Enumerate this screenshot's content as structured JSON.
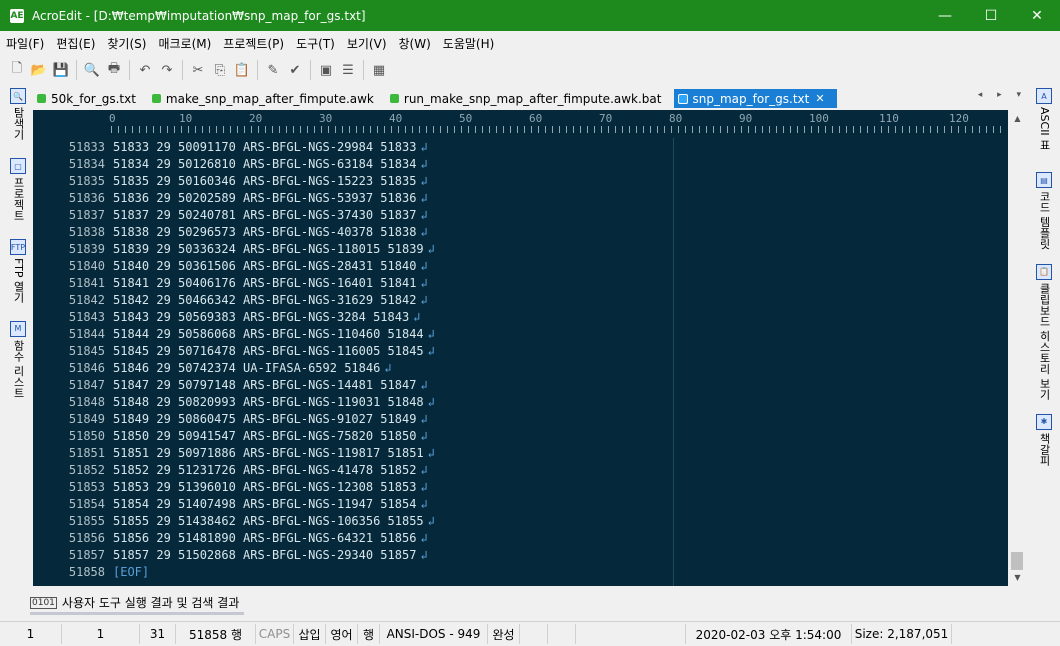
{
  "window": {
    "title": "AcroEdit - [D:₩temp₩imputation₩snp_map_for_gs.txt]",
    "app_icon": "AE",
    "controls": {
      "minimize": "—",
      "maximize": "☐",
      "close": "✕"
    }
  },
  "menubar": [
    "파일(F)",
    "편집(E)",
    "찾기(S)",
    "매크로(M)",
    "프로젝트(P)",
    "도구(T)",
    "보기(V)",
    "창(W)",
    "도움말(H)"
  ],
  "toolbar": [
    {
      "name": "new-file-icon",
      "glyph": "🗋"
    },
    {
      "name": "open-folder-icon",
      "glyph": "📂"
    },
    {
      "name": "save-icon",
      "glyph": "💾"
    },
    {
      "name": "print-preview-icon",
      "glyph": "🔍"
    },
    {
      "name": "print-icon",
      "glyph": "🖶"
    },
    {
      "name": "undo-icon",
      "glyph": "↶"
    },
    {
      "name": "redo-icon",
      "glyph": "↷"
    },
    {
      "name": "cut-icon",
      "glyph": "✂"
    },
    {
      "name": "copy-icon",
      "glyph": "⎘"
    },
    {
      "name": "paste-icon",
      "glyph": "📋"
    },
    {
      "name": "highlight-icon",
      "glyph": "✎"
    },
    {
      "name": "bookmark-icon",
      "glyph": "✔"
    },
    {
      "name": "document-icon",
      "glyph": "▣"
    },
    {
      "name": "list-icon",
      "glyph": "☰"
    },
    {
      "name": "calendar-icon",
      "glyph": "▦"
    }
  ],
  "tabs": [
    {
      "label": "50k_for_gs.txt",
      "active": false
    },
    {
      "label": "make_snp_map_after_fimpute.awk",
      "active": false
    },
    {
      "label": "run_make_snp_map_after_fimpute.awk.bat",
      "active": false
    },
    {
      "label": "snp_map_for_gs.txt",
      "active": true
    }
  ],
  "tab_close": "✕",
  "tab_nav": "◂ ▸ ▾",
  "left_dock": [
    {
      "label": "탐색기",
      "icon": "explorer-icon",
      "glyph": "🔍"
    },
    {
      "label": "프로젝트",
      "icon": "project-icon",
      "glyph": "▢"
    },
    {
      "label": "FTP 열기",
      "icon": "ftp-icon",
      "glyph": "FTP"
    },
    {
      "label": "함수 리스트",
      "icon": "function-list-icon",
      "glyph": "M"
    }
  ],
  "right_dock": [
    {
      "label": "ASCII 표",
      "icon": "ascii-table-icon",
      "glyph": "A"
    },
    {
      "label": "코드 템플릿",
      "icon": "code-template-icon",
      "glyph": "▤"
    },
    {
      "label": "클립보드 히스토리 보기",
      "icon": "clipboard-icon",
      "glyph": "📋"
    },
    {
      "label": "책갈피",
      "icon": "bookmark-panel-icon",
      "glyph": "✱"
    }
  ],
  "ruler": [
    "0",
    "10",
    "20",
    "30",
    "40",
    "50",
    "60",
    "70",
    "80",
    "90",
    "100",
    "110",
    "120"
  ],
  "editor": {
    "line_numbers": [
      "51833",
      "51834",
      "51835",
      "51836",
      "51837",
      "51838",
      "51839",
      "51840",
      "51841",
      "51842",
      "51843",
      "51844",
      "51845",
      "51846",
      "51847",
      "51848",
      "51849",
      "51850",
      "51851",
      "51852",
      "51853",
      "51854",
      "51855",
      "51856",
      "51857",
      "51858"
    ],
    "lines": [
      "51833 29 50091170 ARS-BFGL-NGS-29984 51833",
      "51834 29 50126810 ARS-BFGL-NGS-63184 51834",
      "51835 29 50160346 ARS-BFGL-NGS-15223 51835",
      "51836 29 50202589 ARS-BFGL-NGS-53937 51836",
      "51837 29 50240781 ARS-BFGL-NGS-37430 51837",
      "51838 29 50296573 ARS-BFGL-NGS-40378 51838",
      "51839 29 50336324 ARS-BFGL-NGS-118015 51839",
      "51840 29 50361506 ARS-BFGL-NGS-28431 51840",
      "51841 29 50406176 ARS-BFGL-NGS-16401 51841",
      "51842 29 50466342 ARS-BFGL-NGS-31629 51842",
      "51843 29 50569383 ARS-BFGL-NGS-3284 51843",
      "51844 29 50586068 ARS-BFGL-NGS-110460 51844",
      "51845 29 50716478 ARS-BFGL-NGS-116005 51845",
      "51846 29 50742374 UA-IFASA-6592 51846",
      "51847 29 50797148 ARS-BFGL-NGS-14481 51847",
      "51848 29 50820993 ARS-BFGL-NGS-119031 51848",
      "51849 29 50860475 ARS-BFGL-NGS-91027 51849",
      "51850 29 50941547 ARS-BFGL-NGS-75820 51850",
      "51851 29 50971886 ARS-BFGL-NGS-119817 51851",
      "51852 29 51231726 ARS-BFGL-NGS-41478 51852",
      "51853 29 51396010 ARS-BFGL-NGS-12308 51853",
      "51854 29 51407498 ARS-BFGL-NGS-11947 51854",
      "51855 29 51438462 ARS-BFGL-NGS-106356 51855",
      "51856 29 51481890 ARS-BFGL-NGS-64321 51856",
      "51857 29 51502868 ARS-BFGL-NGS-29340 51857"
    ],
    "eol_marker": "↲",
    "eof_marker": "[EOF]"
  },
  "scrollbar": {
    "up": "▲",
    "down": "▼"
  },
  "output_panel": {
    "label": "사용자 도구 실행 결과 및 검색 결과",
    "icon_glyph": "0101"
  },
  "statusbar": [
    {
      "text": "1",
      "dim": false
    },
    {
      "text": "1",
      "dim": false
    },
    {
      "text": "31",
      "dim": false
    },
    {
      "text": "51858 행",
      "dim": false
    },
    {
      "text": "CAPS",
      "dim": true
    },
    {
      "text": "삽입",
      "dim": false
    },
    {
      "text": "영어",
      "dim": false
    },
    {
      "text": "행",
      "dim": false
    },
    {
      "text": "ANSI-DOS - 949",
      "dim": false
    },
    {
      "text": "완성",
      "dim": false
    },
    {
      "text": "",
      "dim": false
    },
    {
      "text": "",
      "dim": false
    },
    {
      "text": "",
      "dim": false
    },
    {
      "text": "2020-02-03 오후 1:54:00",
      "dim": false
    },
    {
      "text": "Size: 2,187,051",
      "dim": false
    }
  ]
}
